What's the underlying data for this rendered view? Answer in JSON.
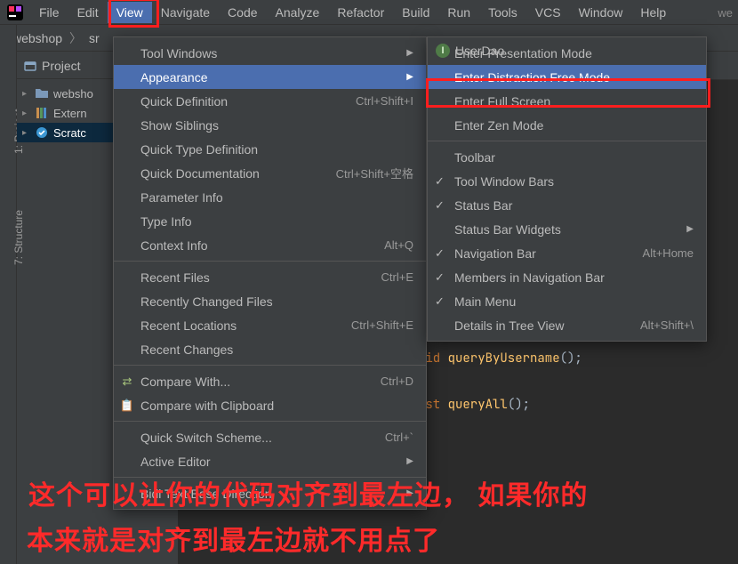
{
  "menubar": {
    "items": [
      "File",
      "Edit",
      "View",
      "Navigate",
      "Code",
      "Analyze",
      "Refactor",
      "Build",
      "Run",
      "Tools",
      "VCS",
      "Window",
      "Help"
    ],
    "open_index": 2,
    "right_text": "we"
  },
  "breadcrumb": {
    "root": "webshop",
    "parts": [
      "sr"
    ]
  },
  "left_stripe": {
    "project_label": "1: Project",
    "structure_label": "7: Structure"
  },
  "project_panel": {
    "title": "Project",
    "tree": [
      {
        "label": "websho",
        "icon": "folder",
        "expanded": true,
        "selected": false
      },
      {
        "label": "Extern",
        "icon": "library",
        "expanded": true,
        "selected": false
      },
      {
        "label": "Scratc",
        "icon": "scratch",
        "expanded": true,
        "selected": true
      }
    ]
  },
  "editor_tab": {
    "filename": "UserDao",
    "icon": "interface-icon"
  },
  "code": {
    "line1_kw": "bid",
    "line1_fn": "queryByUsername",
    "line1_tail": "();",
    "line2_kw": "ist",
    "line2_fn": "queryAll",
    "line2_tail": "();"
  },
  "view_menu": {
    "items": [
      {
        "label": "Tool Windows",
        "submenu": true
      },
      {
        "label": "Appearance",
        "submenu": true,
        "highlight": true
      },
      {
        "label": "Quick Definition",
        "shortcut": "Ctrl+Shift+I"
      },
      {
        "label": "Show Siblings"
      },
      {
        "label": "Quick Type Definition"
      },
      {
        "label": "Quick Documentation",
        "shortcut": "Ctrl+Shift+空格"
      },
      {
        "label": "Parameter Info"
      },
      {
        "label": "Type Info"
      },
      {
        "label": "Context Info",
        "shortcut": "Alt+Q"
      },
      {
        "sep": true
      },
      {
        "label": "Recent Files",
        "shortcut": "Ctrl+E"
      },
      {
        "label": "Recently Changed Files"
      },
      {
        "label": "Recent Locations",
        "shortcut": "Ctrl+Shift+E"
      },
      {
        "label": "Recent Changes"
      },
      {
        "sep": true
      },
      {
        "label": "Compare With...",
        "shortcut": "Ctrl+D",
        "icon": "compare"
      },
      {
        "label": "Compare with Clipboard",
        "icon": "clipboard"
      },
      {
        "sep": true
      },
      {
        "label": "Quick Switch Scheme...",
        "shortcut": "Ctrl+`"
      },
      {
        "label": "Active Editor",
        "submenu": true
      },
      {
        "sep": true
      },
      {
        "label": "Bidi Text Base Direction",
        "submenu": true
      }
    ]
  },
  "appearance_menu": {
    "items": [
      {
        "label": "Enter Presentation Mode"
      },
      {
        "label": "Enter Distraction Free Mode",
        "highlight": true
      },
      {
        "label": "Enter Full Screen"
      },
      {
        "label": "Enter Zen Mode"
      },
      {
        "sep": true
      },
      {
        "label": "Toolbar"
      },
      {
        "label": "Tool Window Bars",
        "checked": true
      },
      {
        "label": "Status Bar",
        "checked": true
      },
      {
        "label": "Status Bar Widgets",
        "submenu": true
      },
      {
        "label": "Navigation Bar",
        "checked": true,
        "shortcut": "Alt+Home"
      },
      {
        "label": "Members in Navigation Bar",
        "checked": true
      },
      {
        "label": "Main Menu",
        "checked": true
      },
      {
        "label": "Details in Tree View",
        "shortcut": "Alt+Shift+\\"
      }
    ]
  },
  "annotation": {
    "line1": "这个可以让你的代码对齐到最左边， 如果你的",
    "line2": "本来就是对齐到最左边就不用点了"
  }
}
